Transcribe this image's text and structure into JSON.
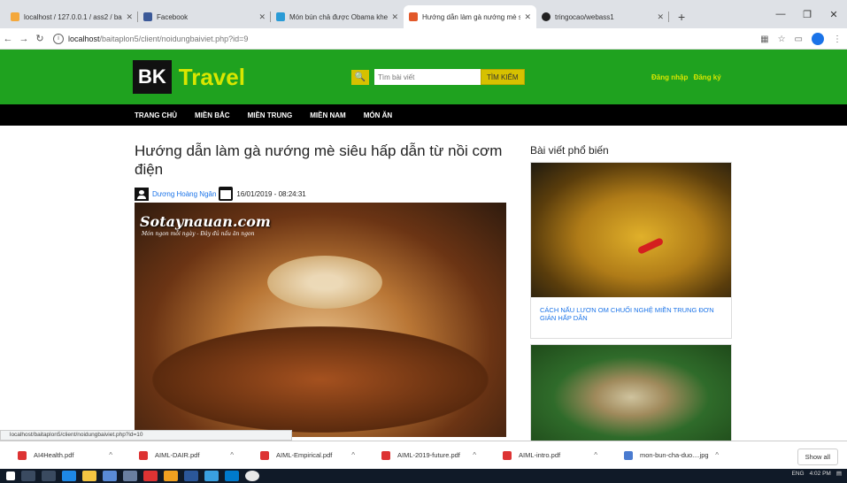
{
  "tabs": [
    {
      "title": "localhost / 127.0.0.1 / ass2 / bai",
      "color": "#f4a83c"
    },
    {
      "title": "Facebook",
      "color": "#3b5998"
    },
    {
      "title": "Món bún chả được Obama khen",
      "color": "#2a9bd6"
    },
    {
      "title": "Hướng dẫn làm gà nướng mè si",
      "color": "#e2582a"
    },
    {
      "title": "tringocao/webass1",
      "color": "#222222"
    }
  ],
  "address": {
    "host": "localhost",
    "path": "/baitaplon5/client/noidungbaiviet.php?id=9"
  },
  "site": {
    "logo_bk": "BK",
    "logo_travel": "Travel",
    "search_placeholder": "Tìm bài viết",
    "search_button": "TÌM KIẾM",
    "login": "Đăng nhập",
    "register": "Đăng ký"
  },
  "menu": [
    "TRANG CHỦ",
    "MIỀN BẮC",
    "MIỀN TRUNG",
    "MIỀN NAM",
    "MÓN ĂN"
  ],
  "article": {
    "title": "Hướng dẫn làm gà nướng mè siêu hấp dẫn từ nồi cơm điện",
    "author": "Dương Hoàng Ngân",
    "date": "16/01/2019 - 08:24:31",
    "watermark": "Sotaynauan.com",
    "watermark_sub": "Món ngon mỗi ngày - Đây đủ nấu ăn ngon"
  },
  "sidebar": {
    "heading": "Bài viết phổ biến",
    "posts": [
      {
        "caption": "CÁCH NẤU LƯƠN OM CHUỐI NGHỆ MIỀN TRUNG ĐƠN GIẢN HẤP DẪN"
      },
      {
        "caption": ""
      }
    ]
  },
  "status_url": "localhost/baitaplon5/client/noidungbaiviet.php?id=10",
  "downloads": [
    {
      "name": "AI4Health.pdf",
      "kind": "pdf"
    },
    {
      "name": "AIML-DAIR.pdf",
      "kind": "pdf"
    },
    {
      "name": "AIML-Empirical.pdf",
      "kind": "pdf"
    },
    {
      "name": "AIML-2019-future.pdf",
      "kind": "pdf"
    },
    {
      "name": "AIML-intro.pdf",
      "kind": "pdf"
    },
    {
      "name": "mon-bun-cha-duo....jpg",
      "kind": "image"
    }
  ],
  "show_all": "Show all",
  "tray": {
    "lang": "ENG",
    "time": "4:02 PM"
  }
}
